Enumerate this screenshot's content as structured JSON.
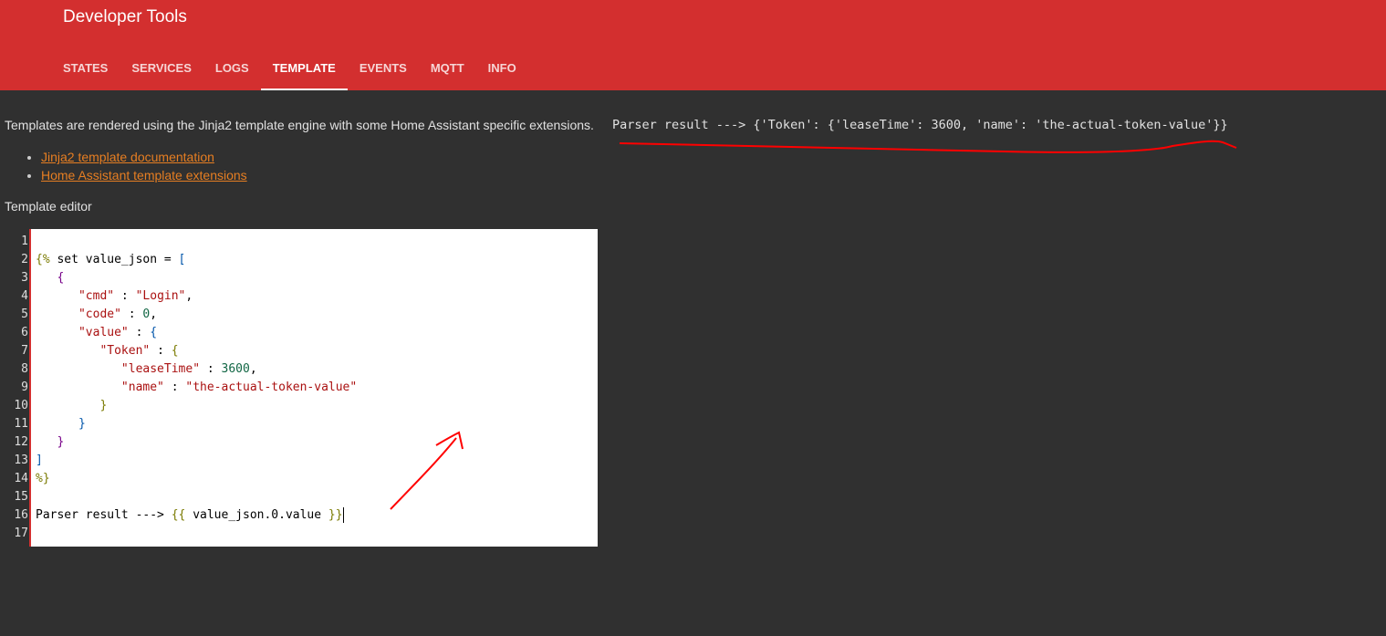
{
  "header": {
    "title": "Developer Tools",
    "tabs": [
      {
        "label": "States"
      },
      {
        "label": "Services"
      },
      {
        "label": "Logs"
      },
      {
        "label": "Template",
        "active": true
      },
      {
        "label": "Events"
      },
      {
        "label": "MQTT"
      },
      {
        "label": "Info"
      }
    ]
  },
  "intro": "Templates are rendered using the Jinja2 template engine with some Home Assistant specific extensions.",
  "links": [
    "Jinja2 template documentation",
    "Home Assistant template extensions"
  ],
  "editor_label": "Template editor",
  "result": "Parser result ---> {'Token': {'leaseTime': 3600, 'name': 'the-actual-token-value'}}",
  "annotation_color": "#ff0000",
  "editor": {
    "lines": [
      [],
      [
        [
          "{%",
          "tag"
        ],
        [
          " set value_json = ",
          ""
        ],
        [
          "[",
          "br"
        ]
      ],
      [
        [
          "   ",
          ""
        ],
        [
          "{",
          "br2"
        ]
      ],
      [
        [
          "      ",
          ""
        ],
        [
          "\"cmd\"",
          "str"
        ],
        [
          " : ",
          ""
        ],
        [
          "\"Login\"",
          "str"
        ],
        [
          ",",
          ""
        ]
      ],
      [
        [
          "      ",
          ""
        ],
        [
          "\"code\"",
          "str"
        ],
        [
          " : ",
          ""
        ],
        [
          "0",
          "num"
        ],
        [
          ",",
          ""
        ]
      ],
      [
        [
          "      ",
          ""
        ],
        [
          "\"value\"",
          "str"
        ],
        [
          " : ",
          ""
        ],
        [
          "{",
          "br"
        ]
      ],
      [
        [
          "         ",
          ""
        ],
        [
          "\"Token\"",
          "str"
        ],
        [
          " : ",
          ""
        ],
        [
          "{",
          "tag"
        ]
      ],
      [
        [
          "            ",
          ""
        ],
        [
          "\"leaseTime\"",
          "str"
        ],
        [
          " : ",
          ""
        ],
        [
          "3600",
          "num"
        ],
        [
          ",",
          ""
        ]
      ],
      [
        [
          "            ",
          ""
        ],
        [
          "\"name\"",
          "str"
        ],
        [
          " : ",
          ""
        ],
        [
          "\"the-actual-token-value\"",
          "str"
        ]
      ],
      [
        [
          "         ",
          ""
        ],
        [
          "}",
          "tag"
        ]
      ],
      [
        [
          "      ",
          ""
        ],
        [
          "}",
          "br"
        ]
      ],
      [
        [
          "   ",
          ""
        ],
        [
          "}",
          "br2"
        ]
      ],
      [
        [
          "]",
          "br"
        ]
      ],
      [
        [
          "%}",
          "tag"
        ]
      ],
      [],
      [
        [
          "Parser result ---> ",
          ""
        ],
        [
          "{{",
          "tag"
        ],
        [
          " value_json.0.value ",
          ""
        ],
        [
          "}}",
          "tag"
        ]
      ],
      []
    ]
  }
}
